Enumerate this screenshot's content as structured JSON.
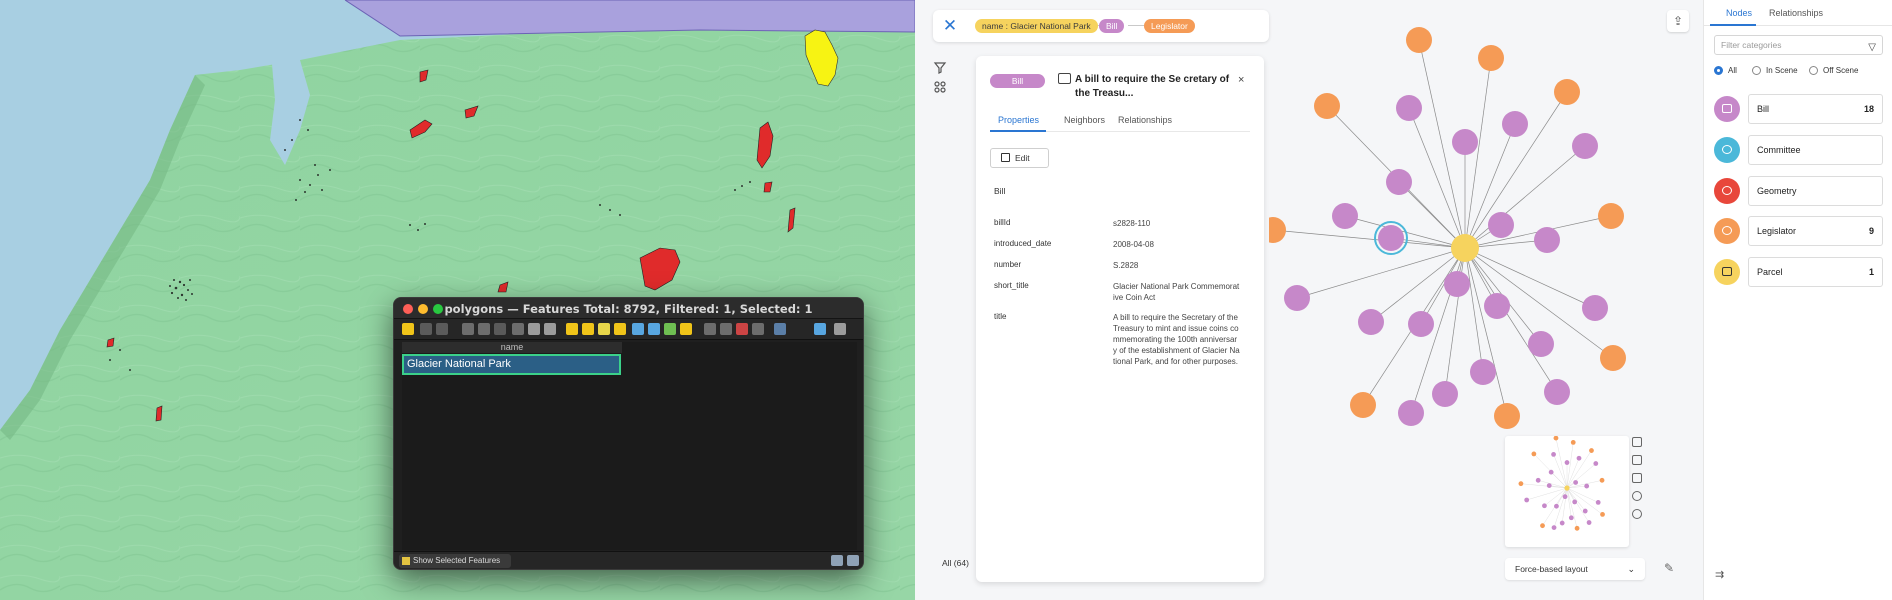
{
  "map": {
    "attribute_window": {
      "title": "polygons — Features Total: 8792, Filtered: 1, Selected: 1",
      "column_header": "name",
      "selected_row": "Glacier National Park",
      "footer_button": "Show Selected Features"
    }
  },
  "graph_app": {
    "search": {
      "chip_name": "name : Glacier National Park",
      "chip_bill": "Bill",
      "chip_legislator": "Legislator"
    },
    "detail": {
      "badge": "Bill",
      "title": "A bill to require the Se cretary of the Treasu...",
      "close": "×",
      "tabs": [
        "Properties",
        "Neighbors",
        "Relationships"
      ],
      "edit_label": "Edit",
      "type_label": "Bill",
      "properties": [
        {
          "key": "billId",
          "value": "s2828-110"
        },
        {
          "key": "introduced_date",
          "value": "2008-04-08"
        },
        {
          "key": "number",
          "value": "S.2828"
        },
        {
          "key": "short_title",
          "value": "Glacier National Park Commemorative Coin Act"
        },
        {
          "key": "title",
          "value": "A bill to require the Secretary of the Treasury to mint and issue coins commemorating the 100th anniversary of the establishment of Glacier National Park, and for other purposes."
        }
      ]
    },
    "all_count": "All (64)",
    "layout_select": "Force-based layout",
    "sidebar": {
      "tabs": [
        "Nodes",
        "Relationships"
      ],
      "filter_placeholder": "Filter categories",
      "scope": [
        "All",
        "In Scene",
        "Off Scene"
      ],
      "categories": [
        {
          "name": "Bill",
          "count": "18",
          "color": "#c688c9"
        },
        {
          "name": "Committee",
          "count": "",
          "color": "#4bb8d9"
        },
        {
          "name": "Geometry",
          "count": "",
          "color": "#e8473b"
        },
        {
          "name": "Legislator",
          "count": "9",
          "color": "#f59b56"
        },
        {
          "name": "Parcel",
          "count": "1",
          "color": "#f6d35e"
        }
      ]
    }
  }
}
